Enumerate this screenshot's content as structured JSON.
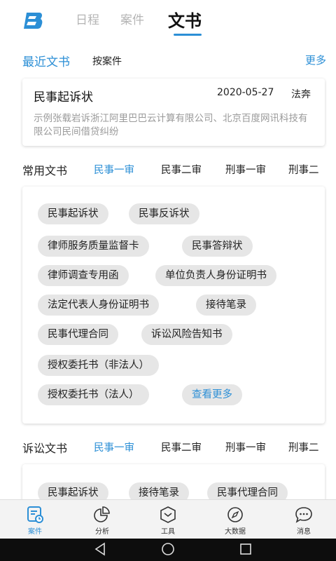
{
  "top_tabs": [
    {
      "label": "日程"
    },
    {
      "label": "案件"
    },
    {
      "label": "文书"
    }
  ],
  "recent": {
    "title": "最近文书",
    "by_case": "按案件",
    "more": "更多",
    "doc": {
      "title": "民事起诉状",
      "date": "2020-05-27",
      "tag": "法奔",
      "desc": "示例张载岩诉浙江阿里巴巴云计算有限公司、北京百度网讯科技有限公司民间借贷纠纷"
    }
  },
  "common": {
    "title": "常用文书",
    "tabs": [
      "民事一审",
      "民事二审",
      "刑事一审",
      "刑事二"
    ],
    "active_tab": "民事一审",
    "chips": [
      "民事起诉状",
      "民事反诉状",
      "律师服务质量监督卡",
      "民事答辩状",
      "律师调查专用函",
      "单位负责人身份证明书",
      "法定代表人身份证明书",
      "接待笔录",
      "民事代理合同",
      "诉讼风险告知书",
      "授权委托书（非法人）",
      "授权委托书（法人）",
      "查看更多"
    ]
  },
  "litigation": {
    "title": "诉讼文书",
    "tabs": [
      "民事一审",
      "民事二审",
      "刑事一审",
      "刑事二"
    ],
    "active_tab": "民事一审",
    "chips": [
      "民事起诉状",
      "接待笔录",
      "民事代理合同"
    ]
  },
  "bottom_nav": [
    {
      "label": "案件",
      "icon": "case-icon",
      "active": true
    },
    {
      "label": "分析",
      "icon": "pie-chart-icon"
    },
    {
      "label": "工具",
      "icon": "toolbox-icon"
    },
    {
      "label": "大数据",
      "icon": "compass-icon"
    },
    {
      "label": "消息",
      "icon": "chat-icon"
    }
  ],
  "colors": {
    "accent": "#2c8fd6",
    "chip_bg": "#e6e6e6",
    "muted": "#9a9a9a"
  }
}
